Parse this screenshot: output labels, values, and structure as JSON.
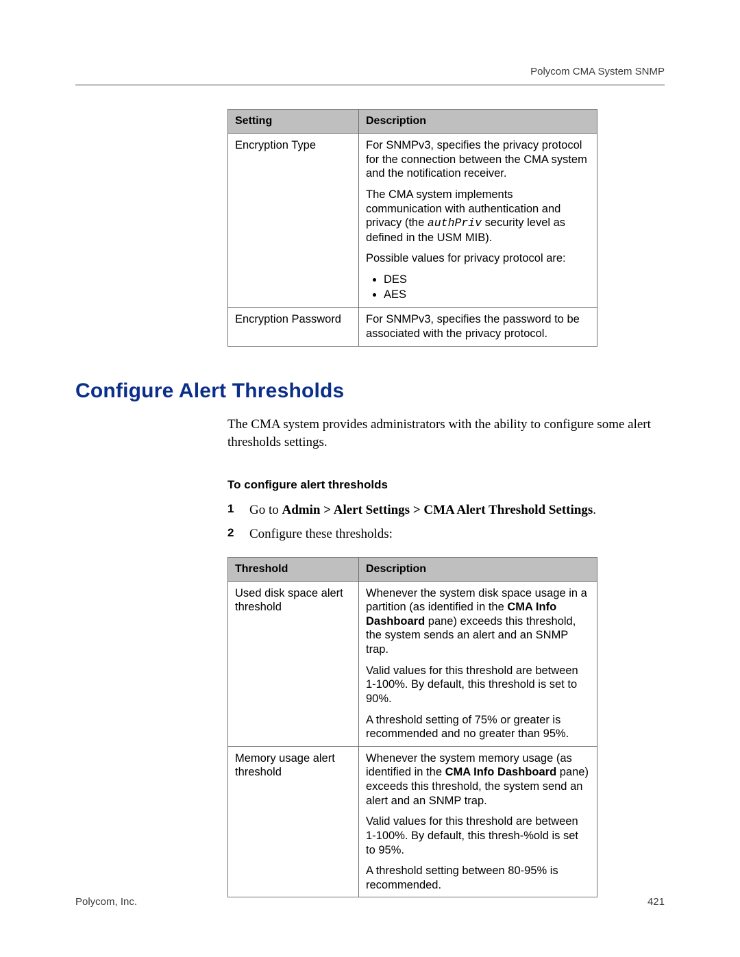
{
  "header": {
    "running_head": "Polycom CMA System SNMP"
  },
  "table1": {
    "headers": {
      "setting": "Setting",
      "description": "Description"
    },
    "rows": [
      {
        "setting": "Encryption Type",
        "p1": "For SNMPv3, specifies the privacy protocol for the connection between the CMA system and the notification receiver.",
        "p2a": "The CMA system implements communication with authentication and privacy (the ",
        "p2code": "authPriv",
        "p2b": " security level as defined in the USM MIB).",
        "p3": "Possible values for privacy protocol are:",
        "li1": "DES",
        "li2": "AES"
      },
      {
        "setting": "Encryption Password",
        "p1": "For SNMPv3, specifies the password to be associated with the privacy protocol."
      }
    ]
  },
  "section": {
    "title": "Configure Alert Thresholds",
    "intro": "The CMA system provides administrators with the ability to configure some alert thresholds settings.",
    "proc_title": "To configure alert thresholds",
    "steps": {
      "n1": "1",
      "s1a": "Go to ",
      "s1b": "Admin > Alert Settings > CMA Alert Threshold Settings",
      "s1c": ".",
      "n2": "2",
      "s2": "Configure these thresholds:"
    }
  },
  "table2": {
    "headers": {
      "threshold": "Threshold",
      "description": "Description"
    },
    "rows": [
      {
        "threshold": "Used disk space alert threshold",
        "p1a": "Whenever the system disk space usage in a partition (as identified in the ",
        "p1b": "CMA Info Dashboard",
        "p1c": " pane) exceeds this threshold, the system sends an alert and an SNMP trap.",
        "p2": "Valid values for this threshold are between 1-100%. By default, this threshold is set to 90%.",
        "p3": "A threshold setting of 75% or greater is recommended and no greater than 95%."
      },
      {
        "threshold": "Memory usage alert threshold",
        "p1a": "Whenever the system memory usage (as identified in the ",
        "p1b": "CMA Info Dashboard",
        "p1c": " pane) exceeds this threshold, the system send an alert and an SNMP trap.",
        "p2": "Valid values for this threshold are between 1-100%. By default, this thresh-%old is set to 95%.",
        "p3": "A threshold setting between 80-95% is recommended."
      }
    ]
  },
  "footer": {
    "left": "Polycom, Inc.",
    "right": "421"
  }
}
